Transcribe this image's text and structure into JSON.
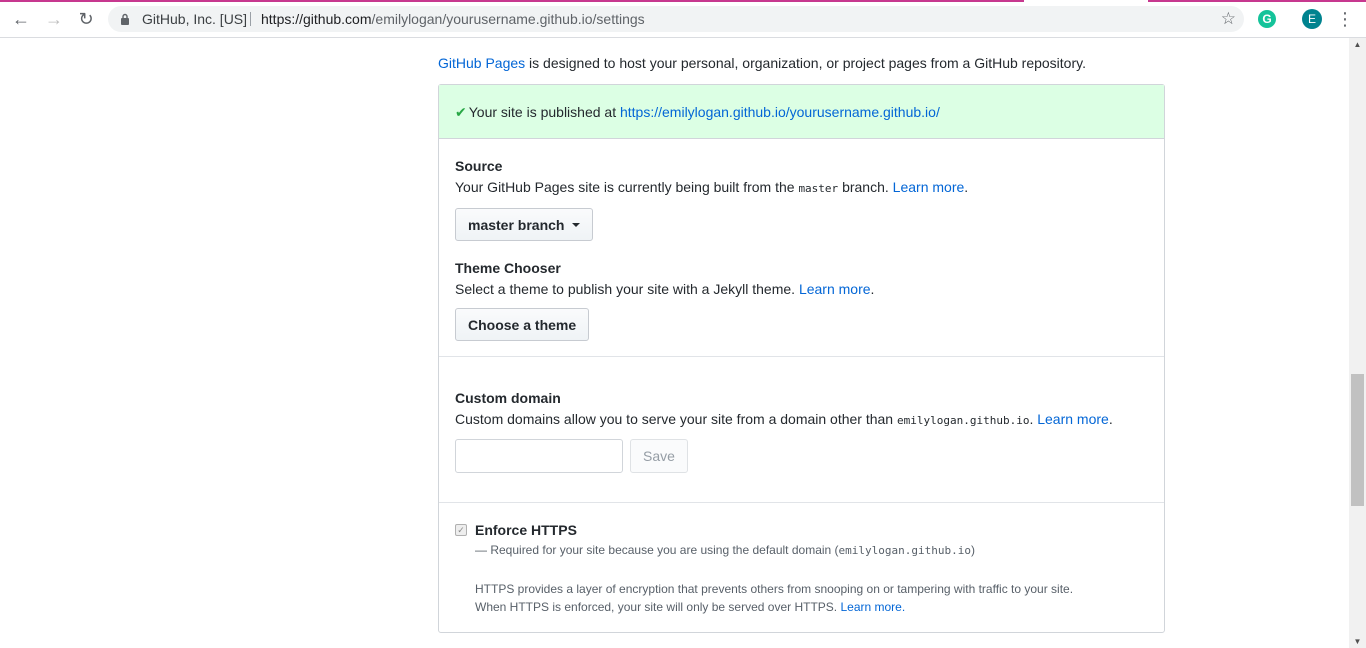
{
  "browser": {
    "org": "GitHub, Inc. [US]",
    "url_host": "https://github.com",
    "url_path": "/emilylogan/yourusername.github.io/settings",
    "avatar_letter": "E",
    "ext_letter": "G"
  },
  "intro": {
    "link": "GitHub Pages",
    "text": " is designed to host your personal, organization, or project pages from a GitHub repository."
  },
  "flash": {
    "text": "Your site is published at ",
    "url": "https://emilylogan.github.io/yourusername.github.io/"
  },
  "source": {
    "heading": "Source",
    "desc_pre": "Your GitHub Pages site is currently being built from the ",
    "branch_code": "master",
    "desc_post": " branch. ",
    "learn_more": "Learn more",
    "dropdown_label": "master branch"
  },
  "theme": {
    "heading": "Theme Chooser",
    "desc": "Select a theme to publish your site with a Jekyll theme. ",
    "learn_more": "Learn more",
    "button": "Choose a theme"
  },
  "custom_domain": {
    "heading": "Custom domain",
    "desc_pre": "Custom domains allow you to serve your site from a domain other than ",
    "domain_code": "emilylogan.github.io",
    "learn_more": "Learn more",
    "input_value": "",
    "save_label": "Save"
  },
  "https": {
    "heading": "Enforce HTTPS",
    "checked": true,
    "required_pre": "— Required for your site because you are using the default domain (",
    "required_code": "emilylogan.github.io",
    "required_post": ")",
    "info_line1": "HTTPS provides a layer of encryption that prevents others from snooping on or tampering with traffic to your site.",
    "info_line2": "When HTTPS is enforced, your site will only be served over HTTPS. ",
    "learn_more": "Learn more."
  },
  "colors": {
    "link": "#0366d6",
    "flash_bg": "#dcffe4",
    "check": "#28a745"
  }
}
